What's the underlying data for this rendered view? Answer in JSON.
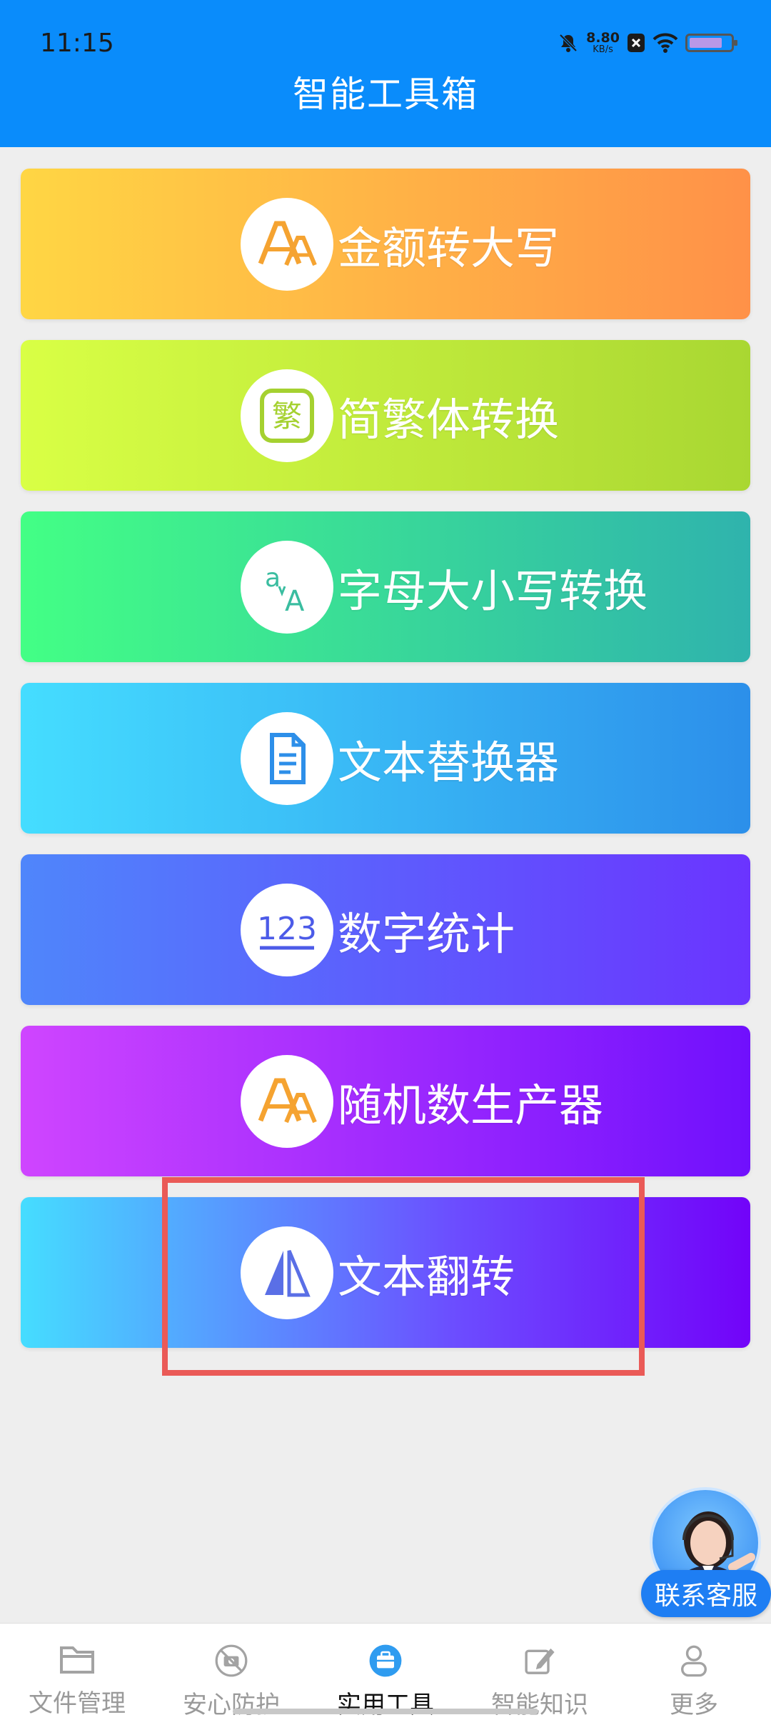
{
  "status_bar": {
    "time": "11:15",
    "net_speed_value": "8.80",
    "net_speed_unit": "KB/s"
  },
  "header": {
    "title": "智能工具箱"
  },
  "tools": [
    {
      "label": "金额转大写",
      "icon": "aa-letters-icon"
    },
    {
      "label": "简繁体转换",
      "icon": "fan-character-icon"
    },
    {
      "label": "字母大小写转换",
      "icon": "case-convert-icon"
    },
    {
      "label": "文本替换器",
      "icon": "document-icon"
    },
    {
      "label": "数字统计",
      "icon": "numbers-123-icon"
    },
    {
      "label": "随机数生产器",
      "icon": "aa-letters-icon"
    },
    {
      "label": "文本翻转",
      "icon": "flip-icon"
    }
  ],
  "support": {
    "label": "联系客服"
  },
  "tabs": [
    {
      "label": "文件管理",
      "icon": "folder-icon",
      "active": false
    },
    {
      "label": "安心防护",
      "icon": "camera-off-icon",
      "active": false
    },
    {
      "label": "实用工具",
      "icon": "toolbox-icon",
      "active": true
    },
    {
      "label": "智能知识",
      "icon": "edit-icon",
      "active": false
    },
    {
      "label": "更多",
      "icon": "person-icon",
      "active": false
    }
  ],
  "colors": {
    "header": "#0a8cfb",
    "highlight": "#ea5a57",
    "tab_active_icon": "#2f9cf0",
    "icon_orange": "#f5a331",
    "icon_green": "#a5d130",
    "icon_teal": "#3abda0",
    "icon_blue": "#2d8fe9",
    "icon_indigo": "#4c5be8"
  }
}
